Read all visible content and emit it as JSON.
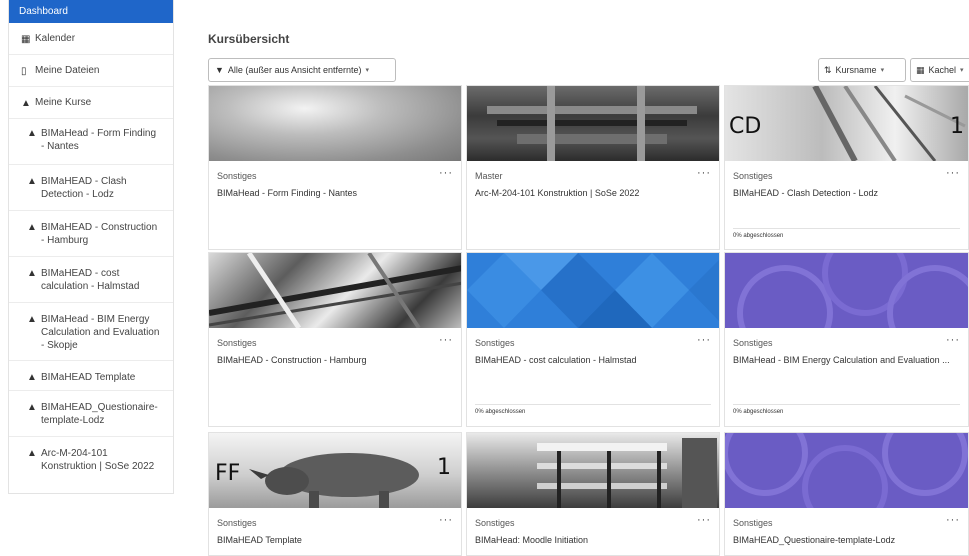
{
  "sidebar": {
    "active_label": "Dashboard",
    "items": [
      {
        "icon": "calendar-icon",
        "glyph": "▦",
        "label": "Kalender"
      },
      {
        "icon": "file-icon",
        "glyph": "▯",
        "label": "Meine Dateien"
      },
      {
        "icon": "graduation-cap-icon",
        "glyph": "🎓",
        "label": "Meine Kurse"
      }
    ],
    "courses": [
      {
        "label": "BIMaHead - Form Finding - Nantes"
      },
      {
        "label": "BIMaHEAD - Clash Detection - Lodz"
      },
      {
        "label": "BIMaHEAD - Construction - Hamburg"
      },
      {
        "label": "BIMaHEAD - cost calculation - Halmstad"
      },
      {
        "label": "BIMaHead - BIM Energy Calculation and Evaluation - Skopje"
      },
      {
        "label": "BIMaHEAD Template"
      },
      {
        "label": "BIMaHEAD_Questionaire-template-Lodz"
      },
      {
        "label": "Arc-M-204-101 Konstruktion | SoSe 2022"
      }
    ]
  },
  "main": {
    "heading": "Kursübersicht",
    "filter_label": "Alle (außer aus Ansicht entfernte)",
    "sort_label": "Kursname",
    "view_label": "Kachel"
  },
  "cards": [
    {
      "category": "Sonstiges",
      "title": "BIMaHead - Form Finding - Nantes",
      "progress": null,
      "overlay_left": "",
      "overlay_right": ""
    },
    {
      "category": "Master",
      "title": "Arc-M-204-101 Konstruktion | SoSe 2022",
      "progress": null,
      "overlay_left": "",
      "overlay_right": ""
    },
    {
      "category": "Sonstiges",
      "title": "BIMaHEAD - Clash Detection - Lodz",
      "progress": "0% abgeschlossen",
      "overlay_left": "CD",
      "overlay_right": "1"
    },
    {
      "category": "Sonstiges",
      "title": "BIMaHEAD - Construction - Hamburg",
      "progress": null,
      "overlay_left": "",
      "overlay_right": ""
    },
    {
      "category": "Sonstiges",
      "title": "BIMaHEAD - cost calculation - Halmstad",
      "progress": "0% abgeschlossen",
      "overlay_left": "",
      "overlay_right": ""
    },
    {
      "category": "Sonstiges",
      "title": "BIMaHead - BIM Energy Calculation and Evaluation ...",
      "progress": "0% abgeschlossen",
      "overlay_left": "",
      "overlay_right": ""
    },
    {
      "category": "Sonstiges",
      "title": "BIMaHEAD Template",
      "progress": null,
      "overlay_left": "FF",
      "overlay_right": "1"
    },
    {
      "category": "Sonstiges",
      "title": "BIMaHead: Moodle Initiation",
      "progress": null,
      "overlay_left": "",
      "overlay_right": ""
    },
    {
      "category": "Sonstiges",
      "title": "BIMaHEAD_Questionaire-template-Lodz",
      "progress": null,
      "overlay_left": "",
      "overlay_right": ""
    }
  ],
  "more_label": "···"
}
